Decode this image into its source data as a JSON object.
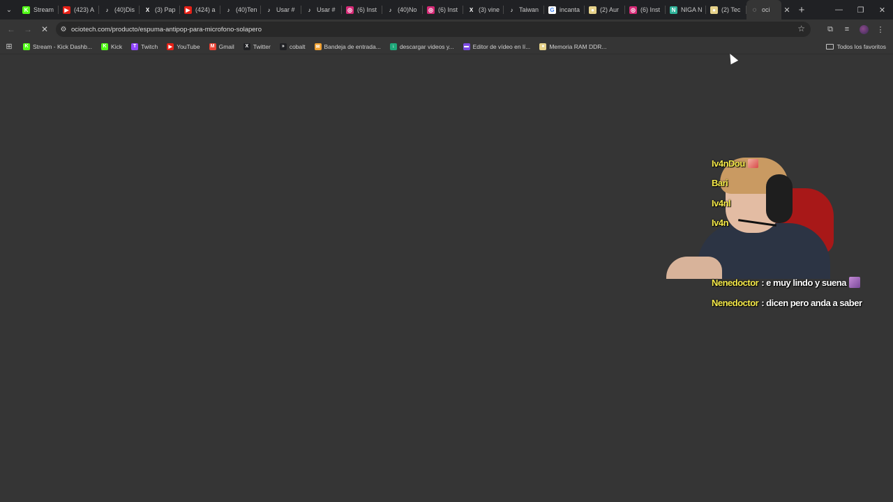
{
  "colors": {
    "tabstrip_bg": "#202124",
    "page_bg": "#353535",
    "chat_user": "#f4e94a",
    "chat_msg": "#ffffff"
  },
  "tabs": [
    {
      "label": "Stream",
      "icon": "kick-icon",
      "icon_color": "#53fc18",
      "glyph": "K"
    },
    {
      "label": "(423) A",
      "icon": "youtube-icon",
      "icon_color": "#e62117",
      "glyph": "▶"
    },
    {
      "label": "(40)Dis",
      "icon": "tiktok-icon",
      "icon_color": "#202124",
      "glyph": "♪"
    },
    {
      "label": "(3) Pap",
      "icon": "x-icon",
      "icon_color": "#202124",
      "glyph": "X"
    },
    {
      "label": "(424) a",
      "icon": "youtube-icon",
      "icon_color": "#e62117",
      "glyph": "▶"
    },
    {
      "label": "(40)Ten",
      "icon": "tiktok-icon",
      "icon_color": "#202124",
      "glyph": "♪"
    },
    {
      "label": "Usar #",
      "icon": "tiktok-icon",
      "icon_color": "#202124",
      "glyph": "♪"
    },
    {
      "label": "Usar #",
      "icon": "tiktok-icon",
      "icon_color": "#202124",
      "glyph": "♪"
    },
    {
      "label": "(6) Inst",
      "icon": "instagram-icon",
      "icon_color": "#d62976",
      "glyph": "◎"
    },
    {
      "label": "(40)No",
      "icon": "tiktok-icon",
      "icon_color": "#202124",
      "glyph": "♪"
    },
    {
      "label": "(6) Inst",
      "icon": "instagram-icon",
      "icon_color": "#d62976",
      "glyph": "◎"
    },
    {
      "label": "(3) vine",
      "icon": "x-icon",
      "icon_color": "#202124",
      "glyph": "X"
    },
    {
      "label": "Taiwan",
      "icon": "tiktok-icon",
      "icon_color": "#202124",
      "glyph": "♪"
    },
    {
      "label": "incanta",
      "icon": "google-icon",
      "icon_color": "#ffffff",
      "glyph": "G"
    },
    {
      "label": "(2) Aur",
      "icon": "ram-icon",
      "icon_color": "#e6d28a",
      "glyph": "●"
    },
    {
      "label": "(6) Inst",
      "icon": "instagram-icon",
      "icon_color": "#d62976",
      "glyph": "◎"
    },
    {
      "label": "NIGA N",
      "icon": "ninja-icon",
      "icon_color": "#2fb39a",
      "glyph": "N"
    },
    {
      "label": "(2) Tec",
      "icon": "ram-icon",
      "icon_color": "#e6d28a",
      "glyph": "●"
    }
  ],
  "active_tab": {
    "label": "oci",
    "icon": "loading-icon"
  },
  "toolbar": {
    "url": "ociotech.com/producto/espuma-antipop-para-microfono-solapero"
  },
  "bookmarks": [
    {
      "label": "Stream - Kick Dashb...",
      "icon": "kick-icon",
      "icon_color": "#53fc18",
      "glyph": "K"
    },
    {
      "label": "Kick",
      "icon": "kick-icon",
      "icon_color": "#53fc18",
      "glyph": "K"
    },
    {
      "label": "Twitch",
      "icon": "twitch-icon",
      "icon_color": "#9146ff",
      "glyph": "T"
    },
    {
      "label": "YouTube",
      "icon": "youtube-icon",
      "icon_color": "#e62117",
      "glyph": "▶"
    },
    {
      "label": "Gmail",
      "icon": "gmail-icon",
      "icon_color": "#ea4335",
      "glyph": "M"
    },
    {
      "label": "Twitter",
      "icon": "x-icon",
      "icon_color": "#202124",
      "glyph": "X"
    },
    {
      "label": "cobalt",
      "icon": "cobalt-icon",
      "icon_color": "#202124",
      "glyph": "»"
    },
    {
      "label": "Bandeja de entrada...",
      "icon": "outlook-icon",
      "icon_color": "#f0a030",
      "glyph": "✉"
    },
    {
      "label": "descargar videos y...",
      "icon": "download-icon",
      "icon_color": "#1fa87a",
      "glyph": "↓"
    },
    {
      "label": "Editor de vídeo en lí...",
      "icon": "video-editor-icon",
      "icon_color": "#7a4ae0",
      "glyph": "▬"
    },
    {
      "label": "Memoria RAM DDR...",
      "icon": "ram-icon",
      "icon_color": "#e6d28a",
      "glyph": "●"
    }
  ],
  "all_bookmarks_label": "Todos los favoritos",
  "chat": [
    {
      "user": "Iv4nDou",
      "msg": "",
      "emote": "small"
    },
    {
      "user": "Bari",
      "msg": ""
    },
    {
      "user": "Iv4nl",
      "msg": ""
    },
    {
      "user": "Iv4n",
      "msg": ""
    },
    {
      "user": "Nenedoctor",
      "msg": ": e muy lindo y suena",
      "emote": "big"
    },
    {
      "user": "Nenedoctor",
      "msg": ": dicen pero anda a saber"
    }
  ]
}
